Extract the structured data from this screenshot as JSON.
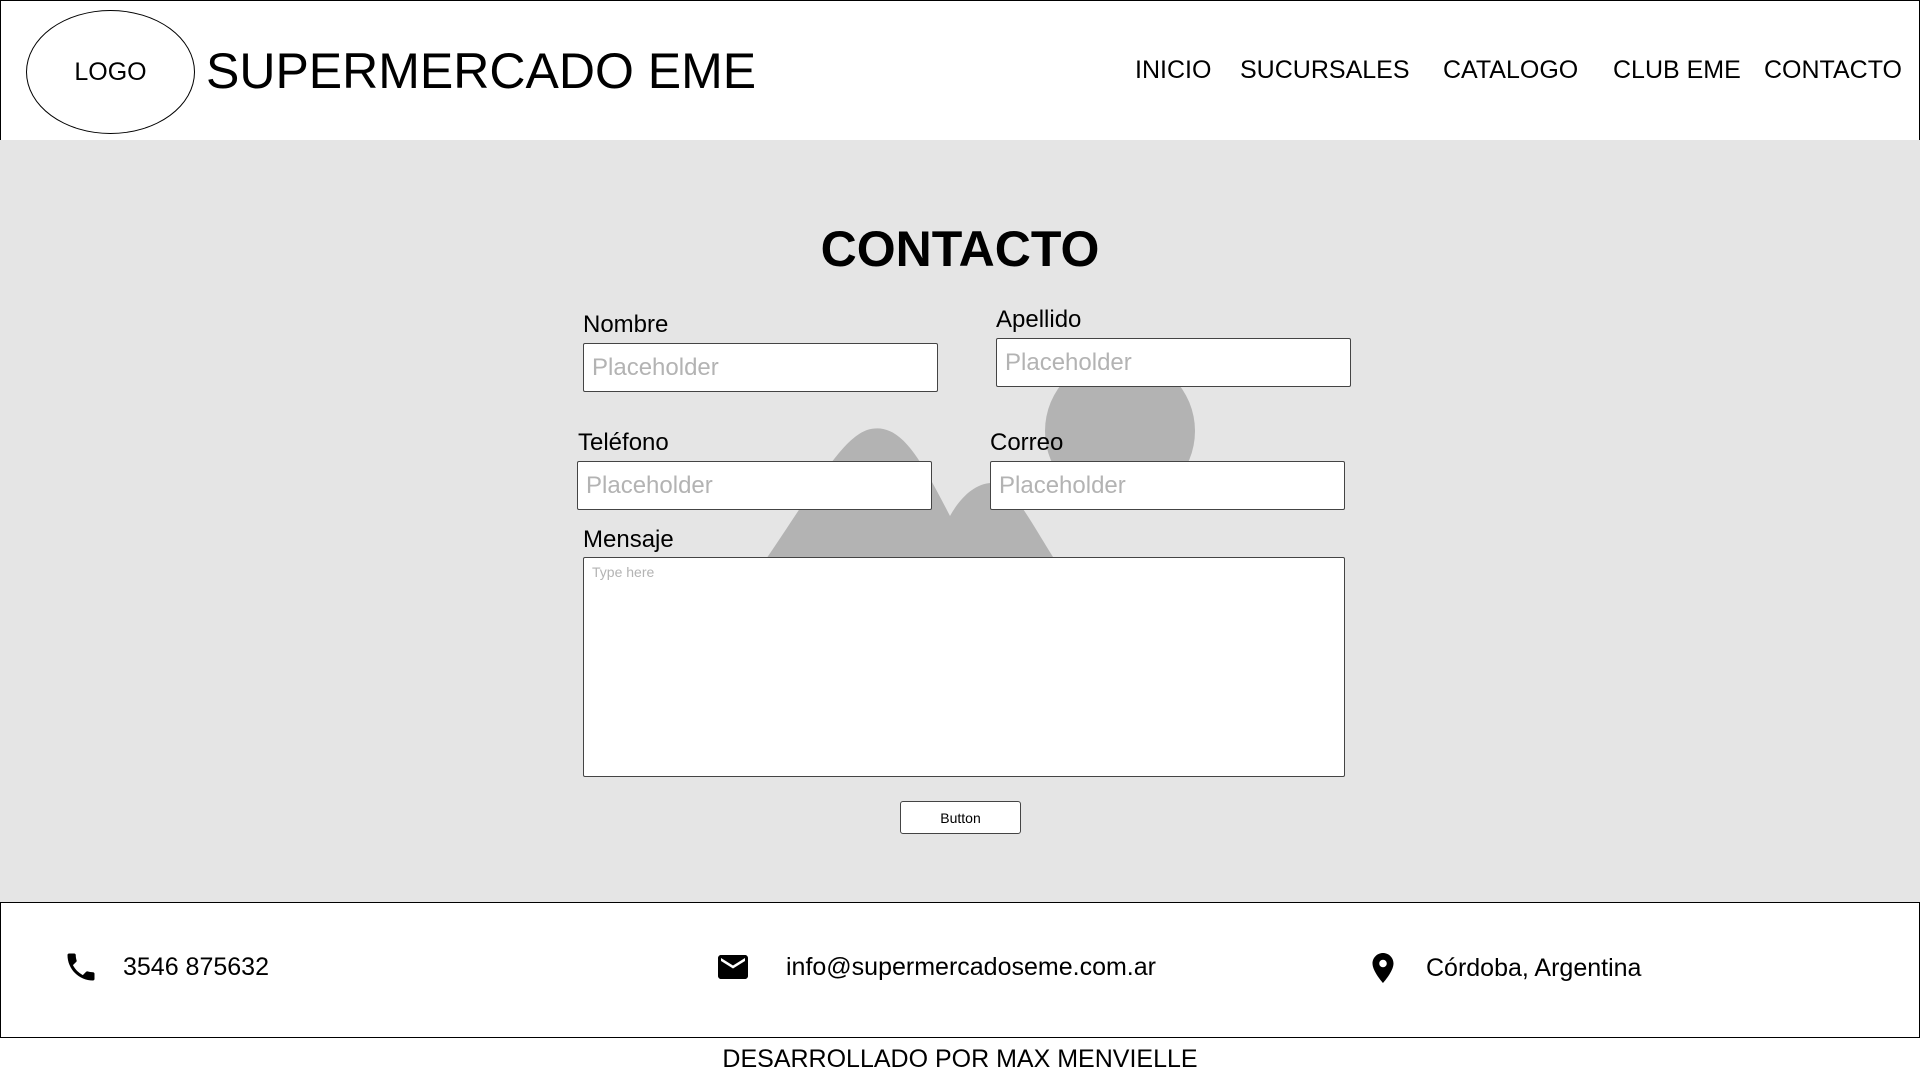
{
  "header": {
    "logo_text": "LOGO",
    "brand": "SUPERMERCADO EME",
    "nav": [
      {
        "label": "INICIO"
      },
      {
        "label": "SUCURSALES"
      },
      {
        "label": "CATALOGO"
      },
      {
        "label": "CLUB EME"
      },
      {
        "label": "CONTACTO"
      }
    ]
  },
  "main": {
    "title": "CONTACTO",
    "fields": {
      "nombre": {
        "label": "Nombre",
        "placeholder": "Placeholder"
      },
      "apellido": {
        "label": "Apellido",
        "placeholder": "Placeholder"
      },
      "telefono": {
        "label": "Teléfono",
        "placeholder": "Placeholder"
      },
      "correo": {
        "label": "Correo",
        "placeholder": "Placeholder"
      },
      "mensaje": {
        "label": "Mensaje",
        "placeholder": "Type here"
      }
    },
    "button_label": "Button",
    "background_image_icon": "image-placeholder-icon"
  },
  "footer": {
    "phone": {
      "icon": "phone-icon",
      "text": "3546 875632"
    },
    "email": {
      "icon": "mail-icon",
      "text": "info@supermercadoseme.com.ar"
    },
    "location": {
      "icon": "location-pin-icon",
      "text": "Córdoba, Argentina"
    }
  },
  "credit": "DESARROLLADO POR MAX MENVIELLE",
  "colors": {
    "main_background": "#e5e5e5",
    "placeholder_image": "#b3b3b3",
    "border": "#000000"
  }
}
